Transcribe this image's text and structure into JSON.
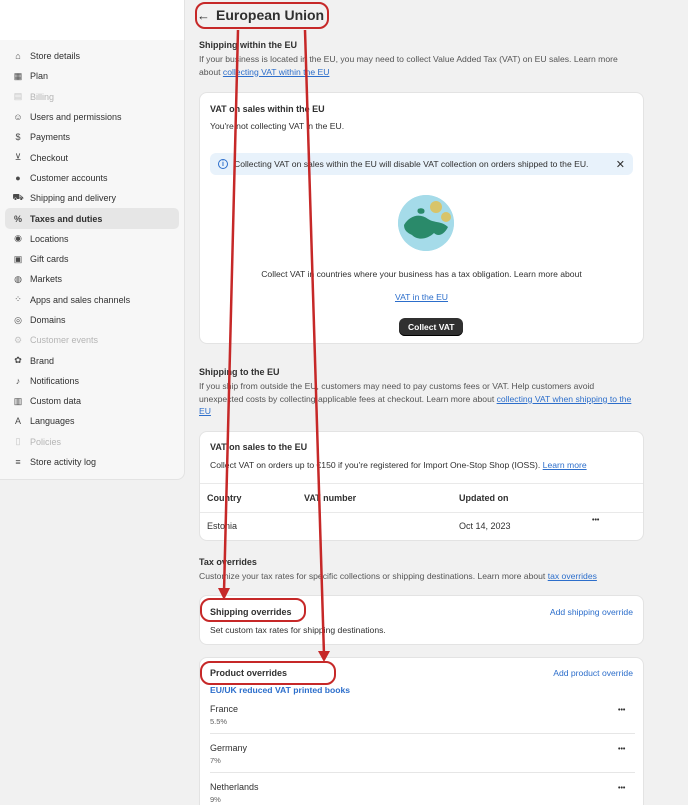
{
  "sidebar": {
    "items": [
      {
        "label": "Store details",
        "icon": "store-icon",
        "glyph": "⌂",
        "state": "normal"
      },
      {
        "label": "Plan",
        "icon": "plan-icon",
        "glyph": "▦",
        "state": "normal"
      },
      {
        "label": "Billing",
        "icon": "billing-icon",
        "glyph": "▤",
        "state": "disabled"
      },
      {
        "label": "Users and permissions",
        "icon": "users-icon",
        "glyph": "☺",
        "state": "normal"
      },
      {
        "label": "Payments",
        "icon": "payments-icon",
        "glyph": "$",
        "state": "normal"
      },
      {
        "label": "Checkout",
        "icon": "cart-icon",
        "glyph": "⊻",
        "state": "normal"
      },
      {
        "label": "Customer accounts",
        "icon": "customer-icon",
        "glyph": "●",
        "state": "normal"
      },
      {
        "label": "Shipping and delivery",
        "icon": "truck-icon",
        "glyph": "⛟",
        "state": "normal"
      },
      {
        "label": "Taxes and duties",
        "icon": "taxes-icon",
        "glyph": "%",
        "state": "active"
      },
      {
        "label": "Locations",
        "icon": "location-icon",
        "glyph": "◉",
        "state": "normal"
      },
      {
        "label": "Gift cards",
        "icon": "gift-icon",
        "glyph": "▣",
        "state": "normal"
      },
      {
        "label": "Markets",
        "icon": "globe-icon",
        "glyph": "◍",
        "state": "normal"
      },
      {
        "label": "Apps and sales channels",
        "icon": "apps-icon",
        "glyph": "⁘",
        "state": "normal"
      },
      {
        "label": "Domains",
        "icon": "domain-icon",
        "glyph": "◎",
        "state": "normal"
      },
      {
        "label": "Customer events",
        "icon": "events-icon",
        "glyph": "⚙",
        "state": "disabled"
      },
      {
        "label": "Brand",
        "icon": "brand-icon",
        "glyph": "✿",
        "state": "normal"
      },
      {
        "label": "Notifications",
        "icon": "bell-icon",
        "glyph": "♪",
        "state": "normal"
      },
      {
        "label": "Custom data",
        "icon": "data-icon",
        "glyph": "▥",
        "state": "normal"
      },
      {
        "label": "Languages",
        "icon": "language-icon",
        "glyph": "A",
        "state": "normal"
      },
      {
        "label": "Policies",
        "icon": "policy-icon",
        "glyph": "▯",
        "state": "disabled"
      },
      {
        "label": "Store activity log",
        "icon": "activity-icon",
        "glyph": "≡",
        "state": "normal"
      }
    ]
  },
  "header": {
    "title": "European Union",
    "back_icon": "back-arrow-icon",
    "back_glyph": "←"
  },
  "shipping_within": {
    "title": "Shipping within the EU",
    "desc": "If your business is located in the EU, you may need to collect Value Added Tax (VAT) on EU sales. Learn more about",
    "link": "collecting VAT within the EU"
  },
  "vat_within_card": {
    "title": "VAT on sales within the EU",
    "subtitle": "You're not collecting VAT in the EU.",
    "banner": "Collecting VAT on sales within the EU will disable VAT collection on orders shipped to the EU.",
    "info_glyph": "i",
    "close_glyph": "✕",
    "empty_text": "Collect VAT in countries where your business has a tax obligation. Learn more about",
    "empty_link": "VAT in the EU",
    "button": "Collect VAT"
  },
  "shipping_to": {
    "title": "Shipping to the EU",
    "desc": "If you ship from outside the EU, customers may need to pay customs fees or VAT. Help customers avoid unexpected costs by collecting applicable fees at checkout. Learn more about",
    "link": "collecting VAT when shipping to the EU"
  },
  "vat_to_card": {
    "title": "VAT on sales to the EU",
    "desc": "Collect VAT on orders up to €150 if you're registered for Import One-Stop Shop (IOSS).",
    "link": "Learn more",
    "columns": [
      "Country",
      "VAT number",
      "Updated on"
    ],
    "rows": [
      {
        "country": "Estonia",
        "vat": "",
        "updated": "Oct 14, 2023"
      }
    ],
    "more_glyph": "•••"
  },
  "tax_overrides": {
    "title": "Tax overrides",
    "desc": "Customize your tax rates for specific collections or shipping destinations. Learn more about",
    "link": "tax overrides"
  },
  "shipping_overrides": {
    "title": "Shipping overrides",
    "desc": "Set custom tax rates for shipping destinations.",
    "action": "Add shipping override"
  },
  "product_overrides": {
    "title": "Product overrides",
    "action": "Add product override",
    "collection": "EU/UK reduced VAT printed books",
    "more_glyph": "•••",
    "rows": [
      {
        "country": "France",
        "rate": "5.5%"
      },
      {
        "country": "Germany",
        "rate": "7%"
      },
      {
        "country": "Netherlands",
        "rate": "9%"
      }
    ]
  },
  "colors": {
    "annotation": "#c62828",
    "link": "#2c6ecb",
    "button": "#303030",
    "banner": "#e8f2fb"
  }
}
